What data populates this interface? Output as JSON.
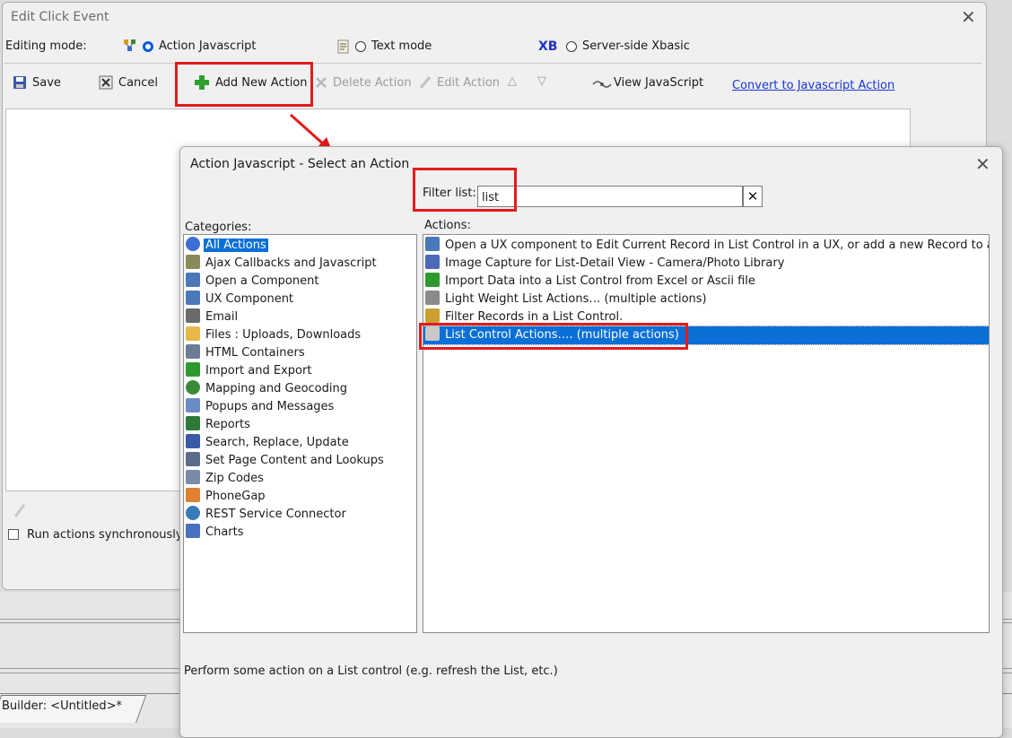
{
  "background": {
    "tab_label": "Builder: <Untitled>*"
  },
  "edit_dialog": {
    "title": "Edit Click Event",
    "editing_mode_label": "Editing mode:",
    "modes": [
      {
        "label": "Action Javascript",
        "checked": true
      },
      {
        "label": "Text mode",
        "checked": false
      },
      {
        "label": "Server-side Xbasic",
        "checked": false
      }
    ],
    "xb_badge": "XB",
    "toolbar": {
      "save": "Save",
      "cancel": "Cancel",
      "add_new_action": "Add New Action",
      "delete_action": "Delete Action",
      "edit_action": "Edit Action",
      "up_arrow": "△",
      "down_arrow": "▽",
      "view_javascript": "View JavaScript",
      "convert_link": "Convert to Javascript Action"
    },
    "run_sync_label": "Run actions synchronously (i"
  },
  "select_dialog": {
    "title": "Action Javascript - Select an Action",
    "filter_label": "Filter list:",
    "filter_value": "list",
    "clear_glyph": "✕",
    "categories_label": "Categories:",
    "actions_label": "Actions:",
    "categories": [
      {
        "label": "All Actions",
        "icon": "globe-icon",
        "color": "#3c6fd6",
        "selected": true
      },
      {
        "label": "Ajax Callbacks and Javascript",
        "icon": "script-icon",
        "color": "#8a8a5a"
      },
      {
        "label": "Open a Component",
        "icon": "form-icon",
        "color": "#4a78b8"
      },
      {
        "label": "UX Component",
        "icon": "form-icon",
        "color": "#4a78b8"
      },
      {
        "label": "Email",
        "icon": "email-icon",
        "color": "#6a6a6a"
      },
      {
        "label": "Files : Uploads, Downloads",
        "icon": "folder-icon",
        "color": "#e8b84a"
      },
      {
        "label": "HTML Containers",
        "icon": "html-icon",
        "color": "#6b7c93"
      },
      {
        "label": "Import and Export",
        "icon": "import-icon",
        "color": "#2e9a2e"
      },
      {
        "label": "Mapping and Geocoding",
        "icon": "globe-icon",
        "color": "#3a8a3a"
      },
      {
        "label": "Popups and Messages",
        "icon": "popup-icon",
        "color": "#6b8cc7"
      },
      {
        "label": "Reports",
        "icon": "report-icon",
        "color": "#2d7a3a"
      },
      {
        "label": "Search, Replace, Update",
        "icon": "search-replace-icon",
        "color": "#3a5aa8"
      },
      {
        "label": "Set Page Content and Lookups",
        "icon": "lookup-icon",
        "color": "#5a6c8a"
      },
      {
        "label": "Zip Codes",
        "icon": "zip-icon",
        "color": "#7a8aa8"
      },
      {
        "label": "PhoneGap",
        "icon": "phonegap-icon",
        "color": "#e08030"
      },
      {
        "label": "REST Service Connector",
        "icon": "globe-icon",
        "color": "#3a7ab8"
      },
      {
        "label": "Charts",
        "icon": "chart-icon",
        "color": "#4a70c0"
      }
    ],
    "actions": [
      {
        "label": "Open a UX component to Edit Current Record in List Control in a UX, or add a new Record to a List Cc",
        "icon": "form-icon",
        "color": "#4a78b8"
      },
      {
        "label": "Image Capture for List-Detail View - Camera/Photo Library",
        "icon": "camera-icon",
        "color": "#4a6ab8"
      },
      {
        "label": "Import Data into a List Control from Excel or Ascii file",
        "icon": "import-icon",
        "color": "#2e9a2e"
      },
      {
        "label": "Light Weight List Actions… (multiple actions)",
        "icon": "database-icon",
        "color": "#8a8a8a"
      },
      {
        "label": "Filter Records in a List Control.",
        "icon": "filter-icon",
        "color": "#c9a030"
      },
      {
        "label": "List Control Actions…. (multiple actions)",
        "icon": "grid-icon",
        "color": "#c8c8c8",
        "selected": true
      }
    ],
    "description": "Perform some action on a List control (e.g. refresh the List, etc.)"
  },
  "colors": {
    "annotation_red": "#e31b1b",
    "selection_blue": "#0b6fd8",
    "link_blue": "#1a36d8"
  }
}
